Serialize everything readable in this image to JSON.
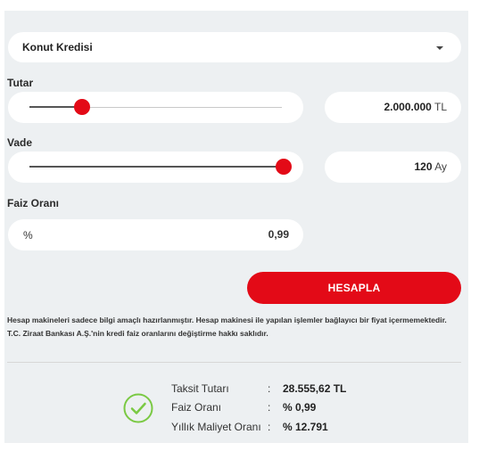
{
  "loan_type": {
    "selected": "Konut Kredisi"
  },
  "amount": {
    "label": "Tutar",
    "value": "2.000.000",
    "unit": "TL",
    "slider_fraction": 0.2
  },
  "term": {
    "label": "Vade",
    "value": "120",
    "unit": "Ay",
    "slider_fraction": 1.0
  },
  "rate": {
    "label": "Faiz Oranı",
    "prefix": "%",
    "value": "0,99"
  },
  "calculate_button": "HESAPLA",
  "disclaimer": "Hesap makineleri sadece bilgi amaçlı hazırlanmıştır. Hesap makinesi ile yapılan işlemler bağlayıcı bir fiyat içermemektedir. T.C. Ziraat Bankası A.Ş.'nin kredi faiz oranlarını değiştirme hakkı saklıdır.",
  "results": {
    "colon": ":",
    "rows": [
      {
        "label": "Taksit Tutarı",
        "value": "28.555,62 TL"
      },
      {
        "label": "Faiz Oranı",
        "value": "% 0,99"
      },
      {
        "label": "Yıllık Maliyet Oranı",
        "value": "% 12.791"
      }
    ]
  },
  "colors": {
    "accent": "#e30a17",
    "success": "#7ac943",
    "panel": "#edf0f2"
  },
  "icons": {
    "dropdown": "chevron-down-icon",
    "success": "check-circle-icon"
  }
}
